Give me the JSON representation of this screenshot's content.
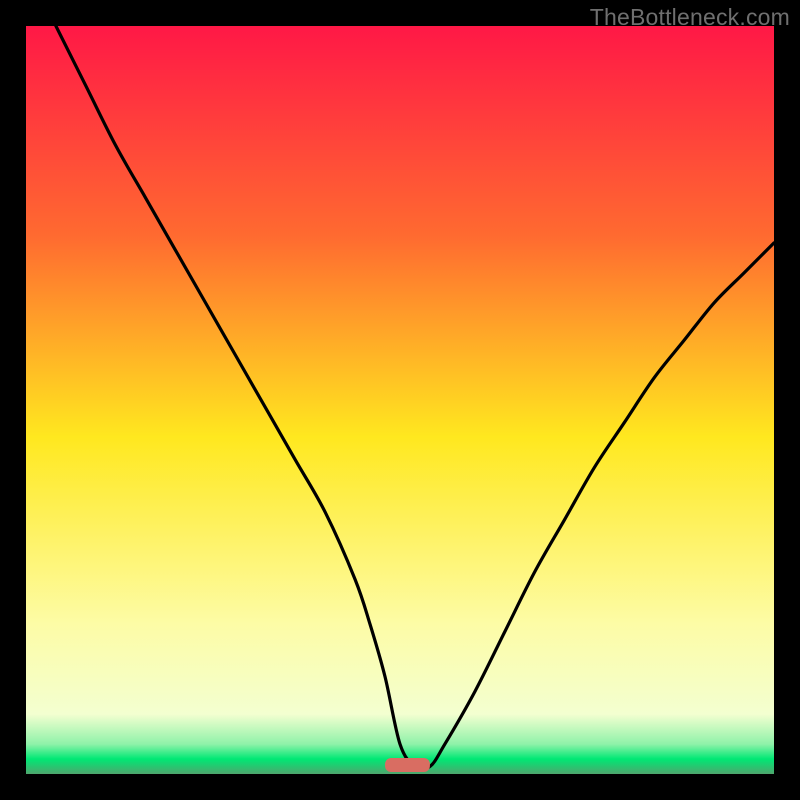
{
  "watermark": "TheBottleneck.com",
  "chart_data": {
    "type": "line",
    "title": "",
    "xlabel": "",
    "ylabel": "",
    "xlim": [
      0,
      100
    ],
    "ylim": [
      0,
      100
    ],
    "grid": false,
    "legend": false,
    "background_gradient": {
      "top": "#ff1846",
      "mid_upper": "#ff8b2e",
      "mid": "#ffe81f",
      "mid_lower": "#fdfca6",
      "green_band": "#00e874",
      "bottom_shadow": "#4ea56d"
    },
    "series": [
      {
        "name": "bottleneck-curve",
        "stroke": "#000000",
        "x": [
          4,
          8,
          12,
          16,
          20,
          24,
          28,
          32,
          36,
          40,
          44,
          46,
          48,
          50,
          52,
          54,
          56,
          60,
          64,
          68,
          72,
          76,
          80,
          84,
          88,
          92,
          96,
          100
        ],
        "y": [
          100,
          92,
          84,
          77,
          70,
          63,
          56,
          49,
          42,
          35,
          26,
          20,
          13,
          4,
          1,
          1,
          4,
          11,
          19,
          27,
          34,
          41,
          47,
          53,
          58,
          63,
          67,
          71
        ]
      }
    ],
    "marker": {
      "name": "optimal-zone-pill",
      "x_center": 51,
      "y": 1.2,
      "width_pct": 6,
      "fill": "#d96d62"
    }
  }
}
